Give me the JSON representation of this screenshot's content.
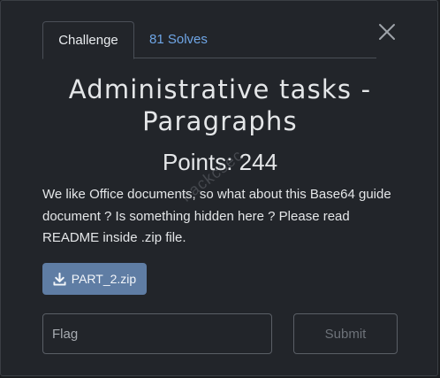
{
  "tabs": {
    "challenge": "Challenge",
    "solves": "81 Solves"
  },
  "challenge": {
    "title": "Administrative tasks - Paragraphs",
    "points": "Points: 244",
    "description": "We like Office documents, so what about this Base64 guide document ? Is something hidden here ? Please read README inside .zip file."
  },
  "file": {
    "name": "PART_2.zip",
    "icon": "download-icon"
  },
  "form": {
    "flag_placeholder": "Flag",
    "submit_label": "Submit"
  },
  "watermark": "hackcsec",
  "colors": {
    "background": "#22252a",
    "tab_link": "#6fa6e6",
    "file_button": "#5f7da4",
    "text": "#e4e6e8"
  }
}
